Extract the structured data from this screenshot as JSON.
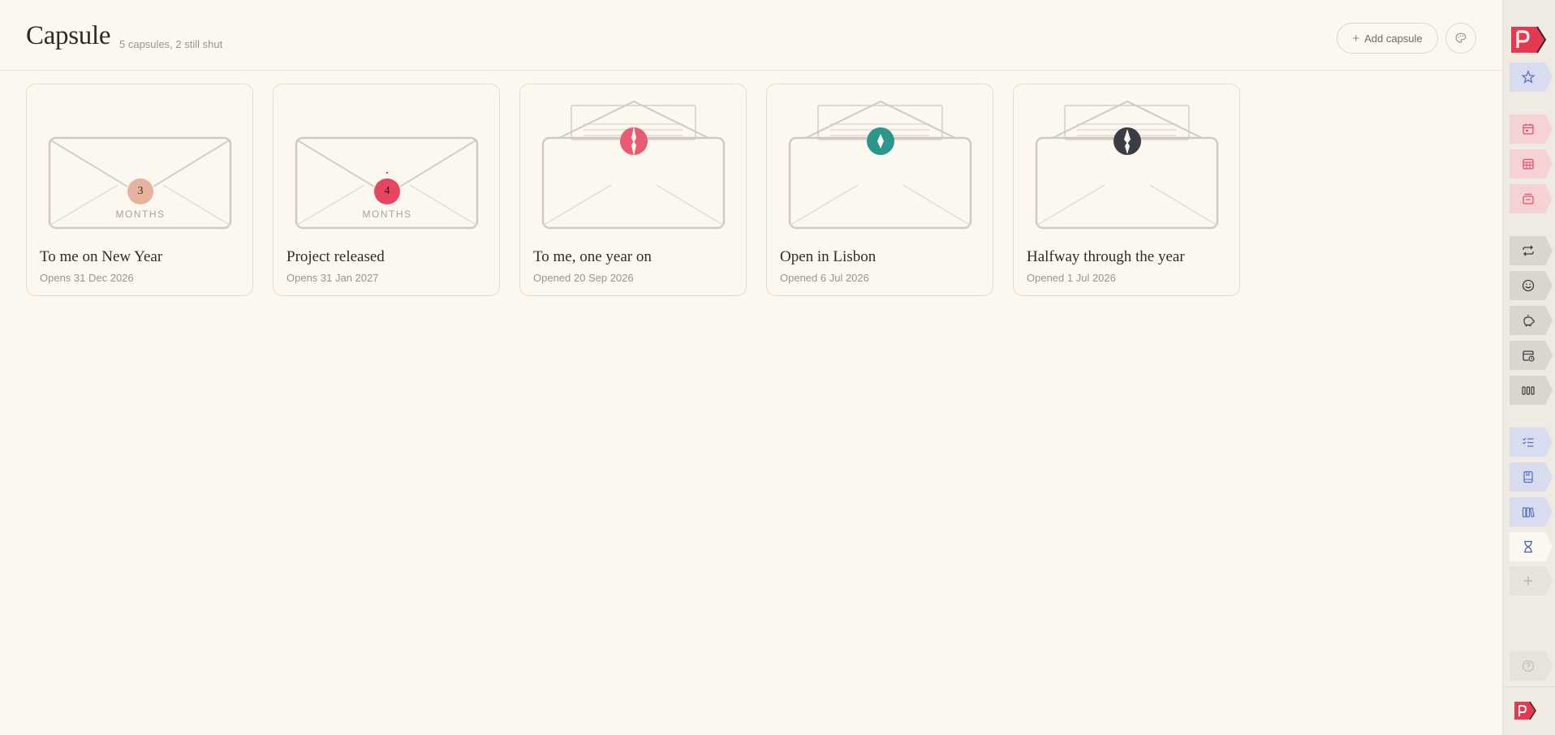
{
  "header": {
    "title": "Capsule",
    "subtitle": "5 capsules, 2 still shut",
    "add_label": "Add capsule",
    "palette_icon": "palette-icon"
  },
  "cards": [
    {
      "title": "To me on New Year",
      "date": "Opens 31 Dec 2026",
      "state": "sealed",
      "seal_color": "#e6b39f",
      "number": "3",
      "unit": "MONTHS"
    },
    {
      "title": "Project released",
      "date": "Opens 31 Jan 2027",
      "state": "sealed",
      "seal_color": "#e8455f",
      "number": "4",
      "unit": "MONTHS"
    },
    {
      "title": "To me, one year on",
      "date": "Opened 20 Sep 2026",
      "state": "opened",
      "seal_color": "#e85b70"
    },
    {
      "title": "Open in Lisbon",
      "date": "Opened 6 Jul 2026",
      "state": "opened",
      "seal_color": "#2a968c"
    },
    {
      "title": "Halfway through the year",
      "date": "Opened 1 Jul 2026",
      "state": "opened",
      "seal_color": "#3a3d45"
    }
  ],
  "sidebar": {
    "logo": "p-logo-icon",
    "tabs": [
      {
        "icon": "star-icon",
        "group": "blue"
      },
      {
        "icon": "calendar-day-icon",
        "group": "pink"
      },
      {
        "icon": "calendar-grid-icon",
        "group": "pink"
      },
      {
        "icon": "calendar-stack-icon",
        "group": "pink"
      },
      {
        "icon": "repeat-icon",
        "group": "gray"
      },
      {
        "icon": "smiley-icon",
        "group": "gray"
      },
      {
        "icon": "piggy-bank-icon",
        "group": "gray"
      },
      {
        "icon": "calendar-clock-icon",
        "group": "gray"
      },
      {
        "icon": "bars-icon",
        "group": "gray"
      },
      {
        "icon": "checklist-icon",
        "group": "blue"
      },
      {
        "icon": "notebook-icon",
        "group": "blue"
      },
      {
        "icon": "books-icon",
        "group": "blue"
      },
      {
        "icon": "hourglass-icon",
        "group": "active"
      },
      {
        "icon": "plus-icon",
        "group": "faint"
      },
      {
        "icon": "help-icon",
        "group": "faint"
      }
    ]
  },
  "colors": {
    "background": "#fdf8ef",
    "accent": "#e63950",
    "tab_blue": "#d9dcef",
    "tab_pink": "#f5d3d5",
    "tab_gray": "#d9d5cf"
  }
}
